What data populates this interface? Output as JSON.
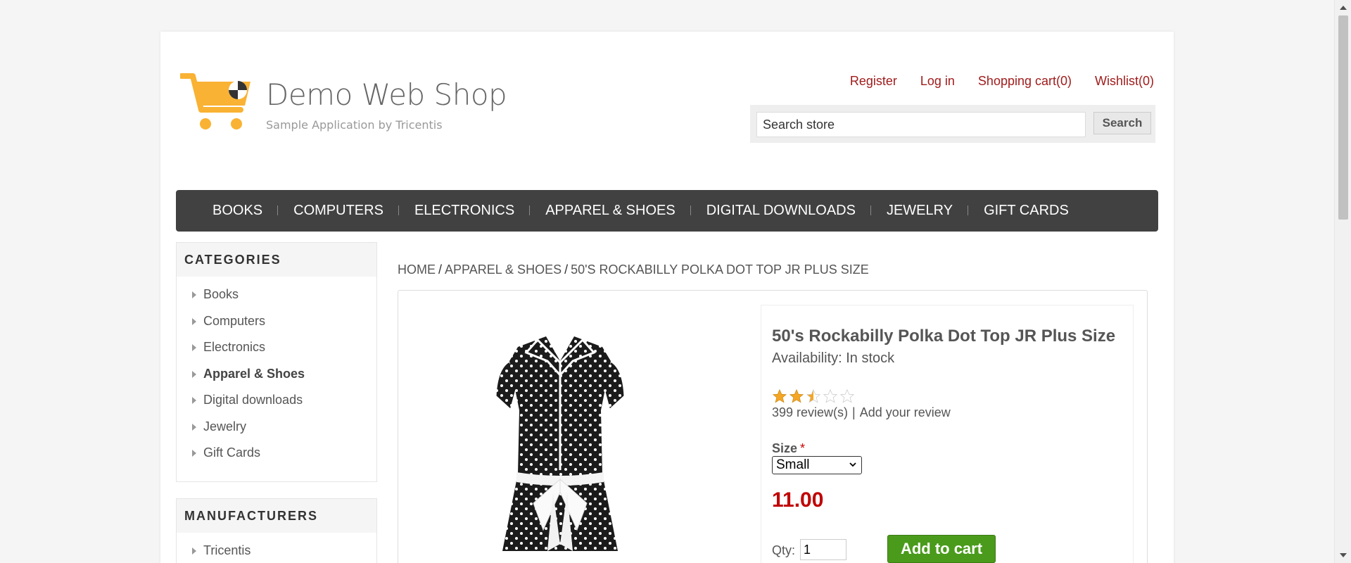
{
  "logo": {
    "title": "Demo Web Shop",
    "subtitle": "Sample Application by Tricentis",
    "brand_color": "#f9b233"
  },
  "header_links": {
    "register": "Register",
    "login": "Log in",
    "cart": "Shopping cart(0)",
    "wishlist": "Wishlist(0)"
  },
  "search": {
    "value": "Search store",
    "button": "Search"
  },
  "nav": [
    "BOOKS",
    "COMPUTERS",
    "ELECTRONICS",
    "APPAREL & SHOES",
    "DIGITAL DOWNLOADS",
    "JEWELRY",
    "GIFT CARDS"
  ],
  "categories": {
    "title": "CATEGORIES",
    "items": [
      "Books",
      "Computers",
      "Electronics",
      "Apparel & Shoes",
      "Digital downloads",
      "Jewelry",
      "Gift Cards"
    ],
    "active": "Apparel & Shoes"
  },
  "manufacturers": {
    "title": "MANUFACTURERS",
    "items": [
      "Tricentis"
    ]
  },
  "breadcrumb": {
    "home": "HOME",
    "category": "APPAREL & SHOES",
    "current": "50'S ROCKABILLY POLKA DOT TOP JR PLUS SIZE",
    "separator": "/"
  },
  "product": {
    "name": "50's Rockabilly Polka Dot Top JR Plus Size",
    "availability": "Availability: In stock",
    "rating": 2.5,
    "rating_max": 5,
    "reviews": "399 review(s)",
    "separator": "|",
    "add_review": "Add your review",
    "size_label": "Size",
    "required_mark": "*",
    "size_selected": "Small",
    "price": "11.00",
    "qty_label": "Qty:",
    "qty": "1",
    "add_to_cart": "Add to cart"
  },
  "colors": {
    "link_red": "#a01c1c",
    "price_red": "#c00000",
    "nav_bg": "#414141",
    "cart_green": "#4a9b1b",
    "star": "#f5a623"
  }
}
